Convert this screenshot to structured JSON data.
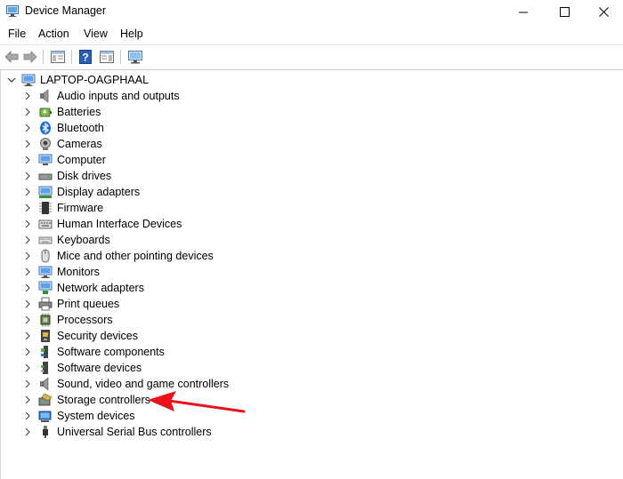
{
  "window": {
    "title": "Device Manager"
  },
  "menu": {
    "file": "File",
    "action": "Action",
    "view": "View",
    "help": "Help"
  },
  "tree": {
    "root": "LAPTOP-OAGPHAAL",
    "items": [
      {
        "label": "Audio inputs and outputs",
        "icon": "speaker-icon"
      },
      {
        "label": "Batteries",
        "icon": "battery-icon"
      },
      {
        "label": "Bluetooth",
        "icon": "bluetooth-icon"
      },
      {
        "label": "Cameras",
        "icon": "camera-icon"
      },
      {
        "label": "Computer",
        "icon": "computer-icon"
      },
      {
        "label": "Disk drives",
        "icon": "disk-drive-icon"
      },
      {
        "label": "Display adapters",
        "icon": "display-adapter-icon"
      },
      {
        "label": "Firmware",
        "icon": "firmware-icon"
      },
      {
        "label": "Human Interface Devices",
        "icon": "hid-icon"
      },
      {
        "label": "Keyboards",
        "icon": "keyboard-icon"
      },
      {
        "label": "Mice and other pointing devices",
        "icon": "mouse-icon"
      },
      {
        "label": "Monitors",
        "icon": "monitor-icon"
      },
      {
        "label": "Network adapters",
        "icon": "network-adapter-icon"
      },
      {
        "label": "Print queues",
        "icon": "printer-icon"
      },
      {
        "label": "Processors",
        "icon": "processor-icon"
      },
      {
        "label": "Security devices",
        "icon": "security-device-icon"
      },
      {
        "label": "Software components",
        "icon": "software-component-icon"
      },
      {
        "label": "Software devices",
        "icon": "software-device-icon"
      },
      {
        "label": "Sound, video and game controllers",
        "icon": "sound-controller-icon"
      },
      {
        "label": "Storage controllers",
        "icon": "storage-controller-icon"
      },
      {
        "label": "System devices",
        "icon": "system-device-icon"
      },
      {
        "label": "Universal Serial Bus controllers",
        "icon": "usb-icon"
      }
    ]
  },
  "colors": {
    "annotation_arrow": "#e8131b",
    "accent_blue": "#1e6fd9"
  }
}
